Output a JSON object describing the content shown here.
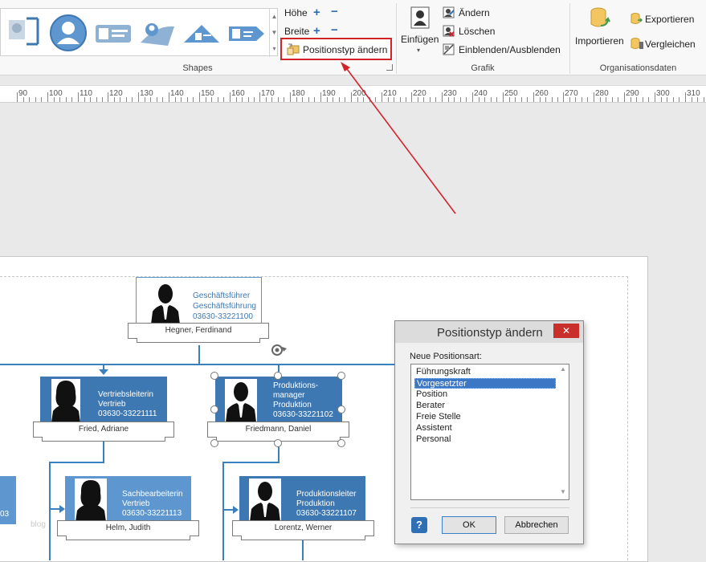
{
  "ribbon": {
    "groups": {
      "shapes": "Shapes",
      "grafik": "Grafik",
      "organisationsdaten": "Organisationsdaten"
    },
    "size": {
      "hoehe": "Höhe",
      "breite": "Breite"
    },
    "positionstyp_button": "Positionstyp ändern",
    "einfuegen": "Einfügen",
    "aendern": "Ändern",
    "loeschen": "Löschen",
    "einblenden": "Einblenden/Ausblenden",
    "importieren": "Importieren",
    "exportieren": "Exportieren",
    "vergleichen": "Vergleichen"
  },
  "ruler": {
    "ticks": [
      "90",
      "100",
      "110",
      "120",
      "130",
      "140",
      "150",
      "160",
      "170",
      "180",
      "190",
      "200",
      "210",
      "220",
      "230",
      "240",
      "250",
      "260",
      "270",
      "280",
      "290",
      "300",
      "310"
    ]
  },
  "org": {
    "top": {
      "lines": [
        "Geschäftsführer",
        "Geschäftsführung",
        "03630-33221100"
      ],
      "name": "Hegner, Ferdinand"
    },
    "vertrieb": {
      "lines": [
        "Vertriebsleiterin",
        "Vertrieb",
        "03630-33221111"
      ],
      "name": "Fried, Adriane"
    },
    "produktion": {
      "lines": [
        "Produktions-",
        "manager",
        "Produktion",
        "03630-33221102"
      ],
      "name": "Friedmann, Daniel"
    },
    "sachbearbeiterin": {
      "lines": [
        "Sachbearbeiterin",
        "Vertrieb",
        "03630-33221113"
      ],
      "name": "Helm, Judith"
    },
    "produktionsleiter": {
      "lines": [
        "Produktionsleiter",
        "Produktion",
        "03630-33221107"
      ],
      "name": "Lorentz, Werner"
    },
    "partial_left": "03",
    "watermark": "blog"
  },
  "dialog": {
    "title": "Positionstyp ändern",
    "close": "✕",
    "prompt": "Neue Positionsart:",
    "options": [
      "Führungskraft",
      "Vorgesetzter",
      "Position",
      "Berater",
      "Freie Stelle",
      "Assistent",
      "Personal"
    ],
    "selected": "Vorgesetzter",
    "ok": "OK",
    "cancel": "Abbrechen",
    "help": "?"
  },
  "colors": {
    "accent": "#3e78b3",
    "highlight_box": "#d1232a",
    "arrow": "#d1232a"
  }
}
